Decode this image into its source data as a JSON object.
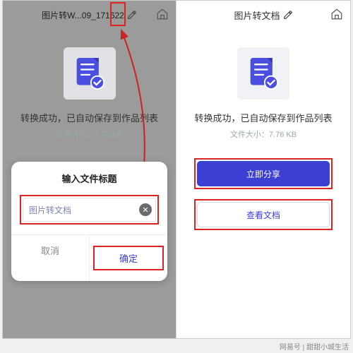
{
  "left": {
    "title": "图片转W...09_171622",
    "dialog": {
      "title": "输入文件标题",
      "input_value": "图片转文档",
      "cancel": "取消",
      "confirm": "确定"
    }
  },
  "right": {
    "title": "图片转文档",
    "success": "转换成功，已自动保存到作品列表",
    "size": "文件大小：7.76 KB",
    "share": "立即分享",
    "view": "查看文档"
  },
  "shared": {
    "success": "转换成功，已自动保存到作品列表",
    "size": "文件大小：7.76 KB"
  },
  "footer": {
    "left": "网易号",
    "right": "甜甜小城生活"
  }
}
